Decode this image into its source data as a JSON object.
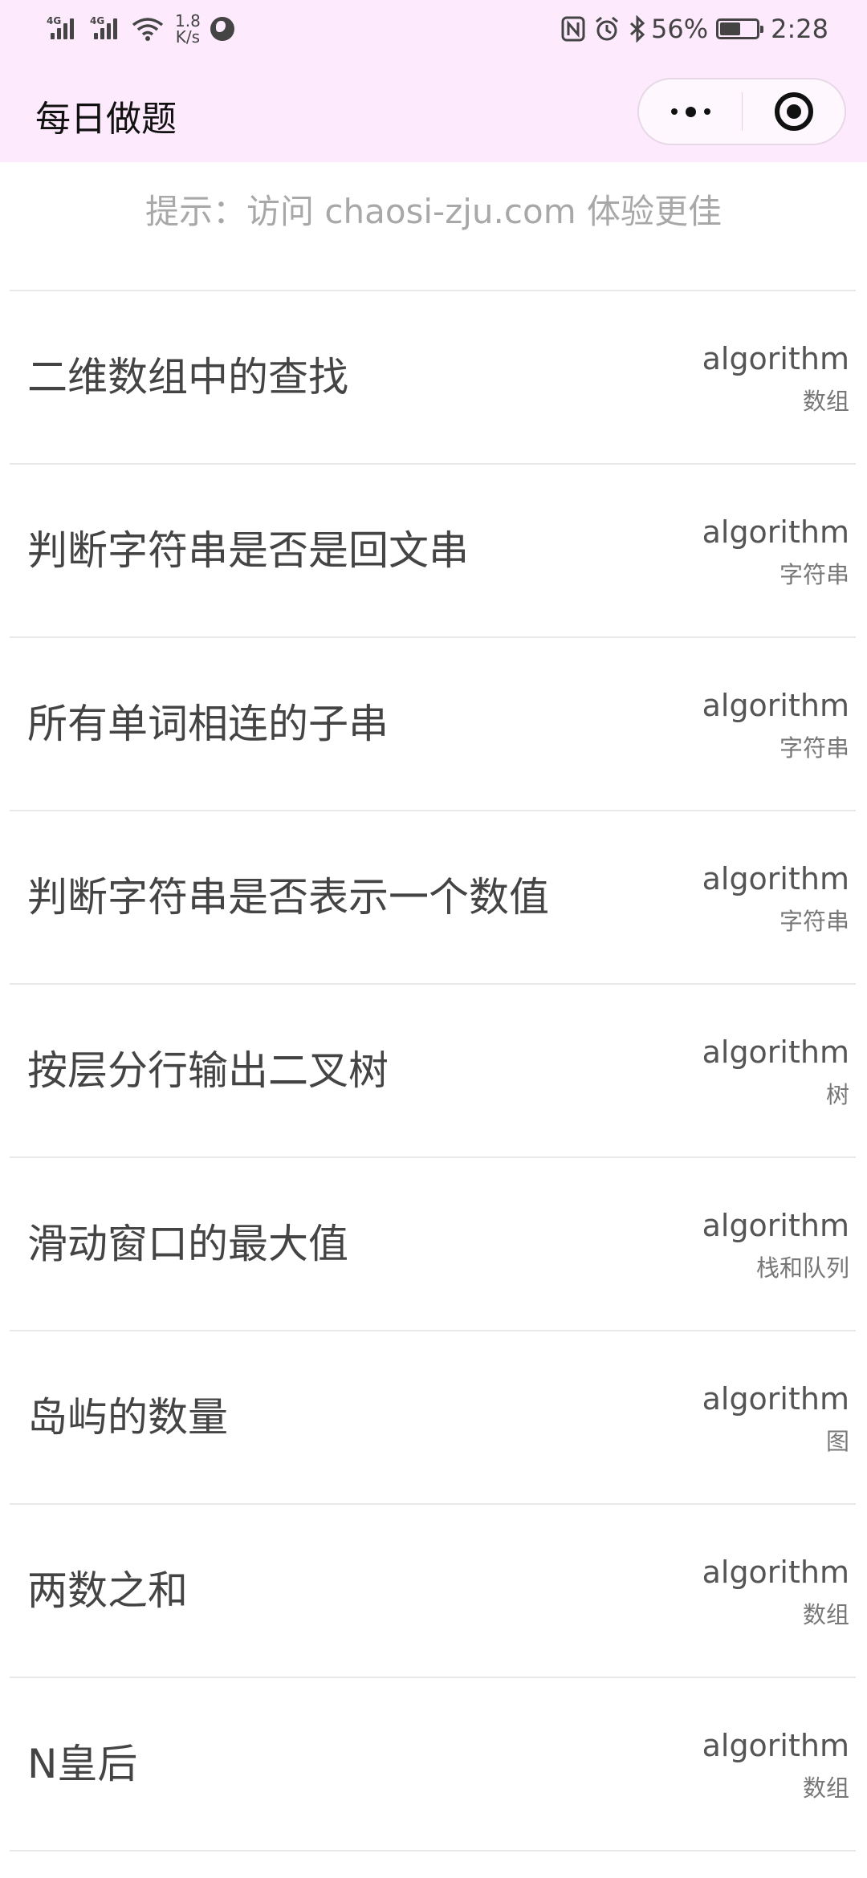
{
  "status_bar": {
    "network_left": "4G",
    "network_right": "4G",
    "speed_value": "1.8",
    "speed_unit": "K/s",
    "battery_percent": "56%",
    "battery_level": 0.56,
    "time": "2:28",
    "icons": [
      "signal-icon",
      "signal-icon",
      "wifi-icon",
      "globe-icon",
      "nfc-icon",
      "alarm-icon",
      "bluetooth-icon",
      "battery-icon"
    ]
  },
  "nav": {
    "title": "每日做题",
    "more_icon": "more-dots-icon",
    "close_icon": "target-icon"
  },
  "hint": "提示：访问 chaosi-zju.com 体验更佳",
  "problems": [
    {
      "title": "二维数组中的查找",
      "category": "algorithm",
      "tag": "数组"
    },
    {
      "title": "判断字符串是否是回文串",
      "category": "algorithm",
      "tag": "字符串"
    },
    {
      "title": "所有单词相连的子串",
      "category": "algorithm",
      "tag": "字符串"
    },
    {
      "title": "判断字符串是否表示一个数值",
      "category": "algorithm",
      "tag": "字符串"
    },
    {
      "title": "按层分行输出二叉树",
      "category": "algorithm",
      "tag": "树"
    },
    {
      "title": "滑动窗口的最大值",
      "category": "algorithm",
      "tag": "栈和队列"
    },
    {
      "title": "岛屿的数量",
      "category": "algorithm",
      "tag": "图"
    },
    {
      "title": "两数之和",
      "category": "algorithm",
      "tag": "数组"
    },
    {
      "title": "N皇后",
      "category": "algorithm",
      "tag": "数组"
    }
  ],
  "colors": {
    "status_bg": "#fdeafd",
    "nav_bg": "#fdeafd",
    "hint_text": "#a8a8a8",
    "divider": "#e8e8e8"
  }
}
